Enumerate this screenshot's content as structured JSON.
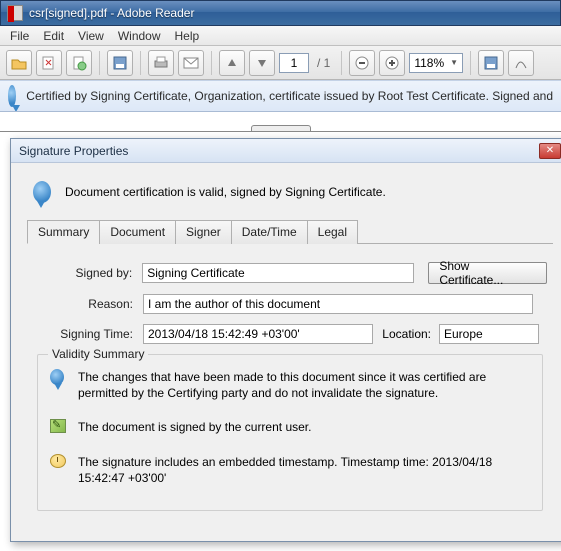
{
  "window": {
    "title": "csr[signed].pdf - Adobe Reader"
  },
  "menu": {
    "file": "File",
    "edit": "Edit",
    "view": "View",
    "window": "Window",
    "help": "Help"
  },
  "toolbar": {
    "page_current": "1",
    "page_total": "/ 1",
    "zoom": "118%"
  },
  "banner": {
    "text": "Certified by Signing Certificate, Organization, certificate issued by Root Test Certificate. Signed and"
  },
  "dialog": {
    "title": "Signature Properties",
    "header_msg": "Document certification is valid, signed by Signing Certificate.",
    "tabs": {
      "summary": "Summary",
      "document": "Document",
      "signer": "Signer",
      "datetime": "Date/Time",
      "legal": "Legal"
    },
    "labels": {
      "signed_by": "Signed by:",
      "reason": "Reason:",
      "signing_time": "Signing Time:",
      "location": "Location:"
    },
    "fields": {
      "signed_by": "Signing Certificate",
      "reason": "I am the author of this document",
      "signing_time": "2013/04/18 15:42:49 +03'00'",
      "location": "Europe"
    },
    "buttons": {
      "show_cert": "Show Certificate..."
    },
    "validity": {
      "title": "Validity Summary",
      "item1": "The changes that have been made to this document since it was certified are permitted by the Certifying party and do not invalidate the signature.",
      "item2": "The document is signed by the current user.",
      "item3": "The signature includes an embedded timestamp. Timestamp time: 2013/04/18 15:42:47 +03'00'"
    }
  }
}
